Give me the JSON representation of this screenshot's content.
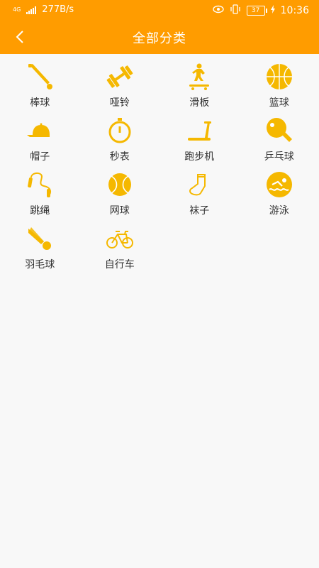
{
  "status_bar": {
    "network": "4G",
    "speed": "277B/s",
    "battery": "37",
    "time": "10:36"
  },
  "header": {
    "title": "全部分类"
  },
  "colors": {
    "primary": "#ff9c00",
    "icon": "#f5b800",
    "background": "#f8f8f8"
  },
  "categories": [
    {
      "label": "棒球",
      "icon": "baseball-bat-icon"
    },
    {
      "label": "哑铃",
      "icon": "dumbbell-icon"
    },
    {
      "label": "滑板",
      "icon": "skateboard-icon"
    },
    {
      "label": "篮球",
      "icon": "basketball-icon"
    },
    {
      "label": "帽子",
      "icon": "cap-icon"
    },
    {
      "label": "秒表",
      "icon": "stopwatch-icon"
    },
    {
      "label": "跑步机",
      "icon": "treadmill-icon"
    },
    {
      "label": "乒乓球",
      "icon": "pingpong-icon"
    },
    {
      "label": "跳绳",
      "icon": "jump-rope-icon"
    },
    {
      "label": "网球",
      "icon": "tennis-ball-icon"
    },
    {
      "label": "袜子",
      "icon": "sock-icon"
    },
    {
      "label": "游泳",
      "icon": "swimming-icon"
    },
    {
      "label": "羽毛球",
      "icon": "shuttlecock-icon"
    },
    {
      "label": "自行车",
      "icon": "bicycle-icon"
    }
  ]
}
